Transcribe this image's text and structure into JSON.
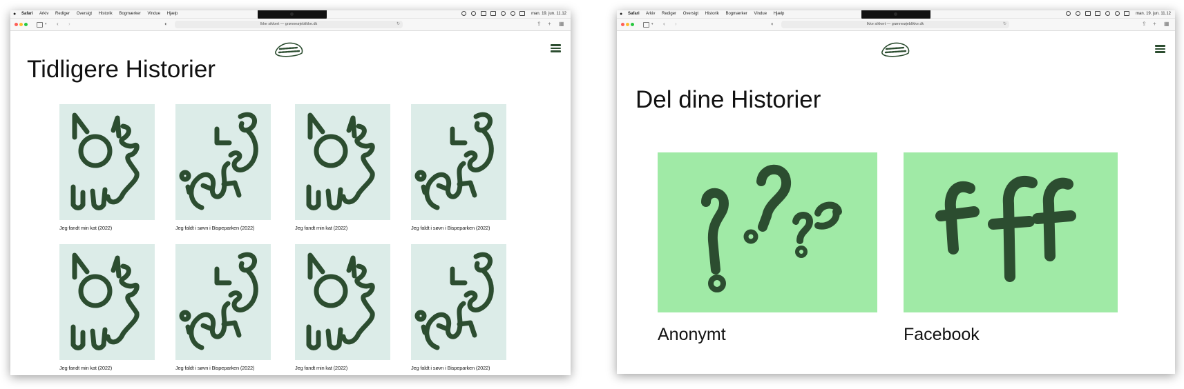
{
  "os": {
    "apple_icon": "apple-logo-icon",
    "app_name": "Safari",
    "menus": [
      "Arkiv",
      "Rediger",
      "Oversigt",
      "Historik",
      "Bogmærker",
      "Vindue",
      "Hjælp"
    ],
    "clock": "man. 19. jun. 11.12"
  },
  "browser": {
    "address": "Ikke sikkert — grønneøjeblikke.dk",
    "reload_icon": "reload-icon"
  },
  "left_page": {
    "title": "Tidligere Historier",
    "stories": [
      {
        "caption": "Jeg fandt min kat (2022)",
        "art": "cat"
      },
      {
        "caption": "Jeg faldt i søvn i Bispeparken (2022)",
        "art": "sleep"
      },
      {
        "caption": "Jeg fandt min kat (2022)",
        "art": "cat"
      },
      {
        "caption": "Jeg faldt i søvn i Bispeparken (2022)",
        "art": "sleep"
      },
      {
        "caption": "Jeg fandt min kat (2022)",
        "art": "cat"
      },
      {
        "caption": "Jeg faldt i søvn i Bispeparken (2022)",
        "art": "sleep"
      },
      {
        "caption": "Jeg fandt min kat (2022)",
        "art": "cat"
      },
      {
        "caption": "Jeg faldt i søvn i Bispeparken (2022)",
        "art": "sleep"
      }
    ]
  },
  "right_page": {
    "title": "Del dine Historier",
    "options": [
      {
        "label": "Anonymt",
        "art": "question-marks"
      },
      {
        "label": "Facebook",
        "art": "fff"
      }
    ]
  },
  "colors": {
    "brand_green": "#2c4d30",
    "thumb_bg": "#dcece8",
    "tile_bg": "#a0eaa6"
  }
}
